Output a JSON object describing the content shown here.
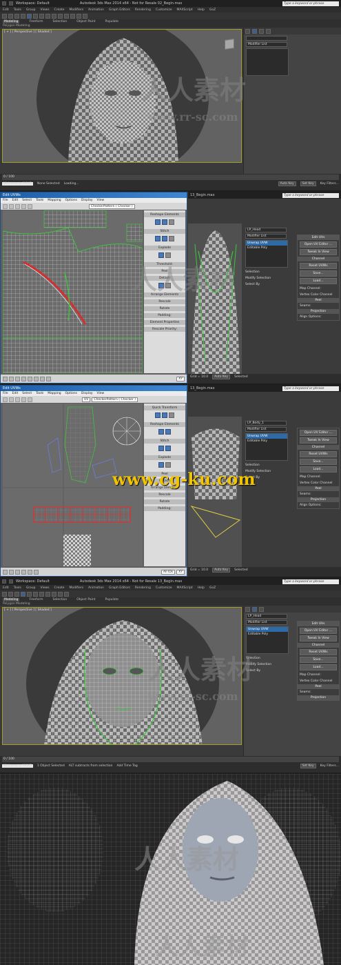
{
  "app": {
    "title_1": "Autodesk 3ds Max 2014 x64 - Not for Resale  02_Begin.max",
    "title_2": "13_Begin.max",
    "title_3": "13_Begin.max",
    "title_4": "Autodesk 3ds Max 2014 x64 - Not for Resale  13_Begin.max",
    "workspace": "Workspace: Default",
    "search_placeholder": "Type a keyword or phrase"
  },
  "menu": [
    "Edit",
    "Tools",
    "Group",
    "Views",
    "Create",
    "Modifiers",
    "Animation",
    "Graph Editors",
    "Rendering",
    "Customize",
    "MAXScript",
    "Help",
    "GoZ"
  ],
  "ribbon": {
    "tabs": [
      "Modeling",
      "Freeform",
      "Selection",
      "Object Paint",
      "Populate"
    ],
    "active": "Modeling",
    "sub": "Polygon Modeling"
  },
  "viewport": {
    "label": "[ + ] [ Perspective ] [ Shaded ]"
  },
  "command_panel": {
    "object_name_1": "",
    "object_name_2": "LP_Head",
    "object_name_3": "LP_Body_1",
    "object_name_4": "LP_Head",
    "modifier_list": "Modifier List",
    "stack": [
      "Unwrap UVW",
      "Editable Poly"
    ],
    "rollouts": {
      "edit_uvs": "Edit UVs",
      "open_editor": "Open UV Editor ...",
      "tweak": "Tweak In View",
      "channel": "Channel",
      "reset": "Reset UVWs",
      "save": "Save...",
      "load": "Load...",
      "map_channel": "Map Channel:",
      "vertex_color": "Vertex Color Channel",
      "peel": "Peel",
      "seams": "Seams:",
      "projection": "Projection",
      "align": "Align Options:",
      "selection": "Selection",
      "modify_selection": "Modify Selection",
      "select_by": "Select By"
    }
  },
  "status": {
    "frame": "0 / 100",
    "maxscript": "Welcome to MAXS",
    "none_selected": "None Selected",
    "objects_selected": "1 Object Selected",
    "loading": "Loading...",
    "alt_subtract": "ALT subtracts from selection",
    "grid": "Grid = 10.0",
    "add_time_tag": "Add Time Tag",
    "auto_key": "Auto Key",
    "set_key": "Set Key",
    "selected": "Selected",
    "key_filters": "Key Filters..."
  },
  "uv_editor": {
    "title": "Edit UVWs",
    "menu": [
      "File",
      "Edit",
      "Select",
      "Tools",
      "Mapping",
      "Options",
      "Display",
      "View"
    ],
    "pattern": "CheckerPattern  ( Checker )",
    "uv": "UV",
    "sections": {
      "quick_transform": "Quick Transform",
      "reshape": "Reshape Elements",
      "stitch": "Stitch",
      "explode": "Explode",
      "threshold": "Threshold:",
      "peel": "Peel",
      "detach": "Detach",
      "arrange": "Arrange Elements",
      "rescale": "Rescale",
      "rotate": "Rotate",
      "padding": "Padding:",
      "element_props": "Element Properties",
      "rescale_priority": "Rescale Priority:"
    },
    "xy": "XY",
    "all_ids": "All IDs"
  },
  "watermarks": {
    "cn_brand": "人人素材",
    "rr_url": "www.rr-sc.com",
    "cg_url": "www.cg-ku.com"
  },
  "colors": {
    "viewport_bg": "#626262",
    "selection_blue": "#2c6aa8",
    "seam_green": "#3fc43f",
    "seam_red": "#d23030",
    "watermark_yellow": "#f2c400"
  }
}
